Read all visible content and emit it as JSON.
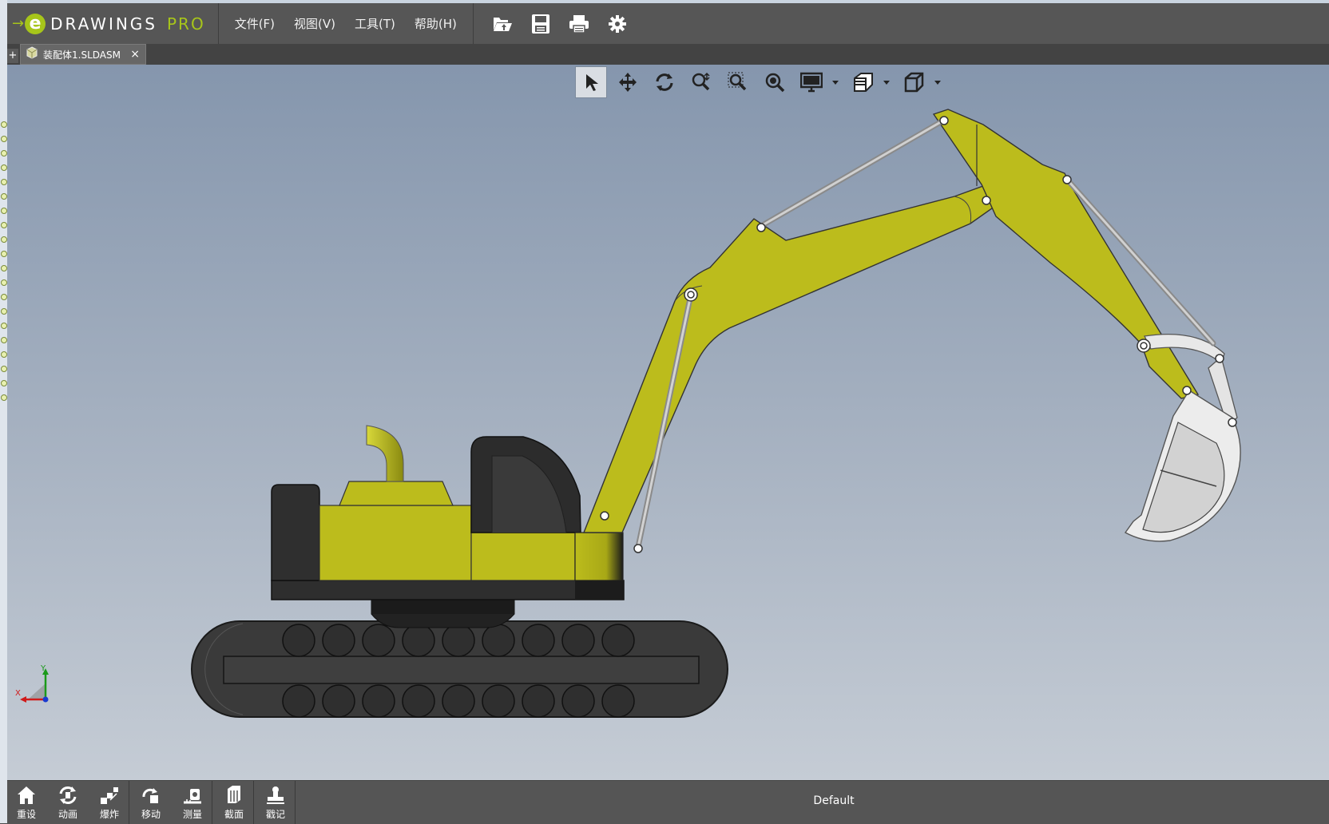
{
  "app": {
    "logo_arrow": "→",
    "logo_e": "e",
    "brand": "DRAWINGS",
    "edition": "PRO"
  },
  "menu": {
    "file": "文件(F)",
    "view": "视图(V)",
    "tools": "工具(T)",
    "help": "帮助(H)"
  },
  "toolbar": {
    "icons": [
      "open-icon",
      "save-icon",
      "print-icon",
      "settings-icon"
    ]
  },
  "tabs": {
    "add_label": "+",
    "active": {
      "name": "装配体1.SLDASM",
      "close": "×"
    }
  },
  "view_toolbar": {
    "icons": [
      "select-icon",
      "pan-icon",
      "rotate-icon",
      "zoom-to-fit-icon",
      "zoom-to-area-icon",
      "zoom-in-out-icon",
      "display-style-icon",
      "section-view-icon",
      "standard-views-icon"
    ],
    "selected": "select-icon"
  },
  "triad": {
    "x": "X",
    "y": "Y"
  },
  "bottom_toolbar": {
    "buttons": [
      {
        "label": "重设",
        "icon": "home-icon"
      },
      {
        "label": "动画",
        "icon": "animate-icon"
      },
      {
        "label": "爆炸",
        "icon": "explode-icon"
      },
      {
        "label": "移动",
        "icon": "move-icon"
      },
      {
        "label": "测量",
        "icon": "measure-icon"
      },
      {
        "label": "截面",
        "icon": "section-icon"
      },
      {
        "label": "戳记",
        "icon": "stamp-icon"
      }
    ],
    "configuration": "Default"
  },
  "colors": {
    "chrome": "#565656",
    "accent": "#a7c51a",
    "model_yellow": "#bcbc1c",
    "model_dark": "#2f2f2f",
    "viewport_top": "#8596ad",
    "viewport_bottom": "#c5ccd5"
  }
}
